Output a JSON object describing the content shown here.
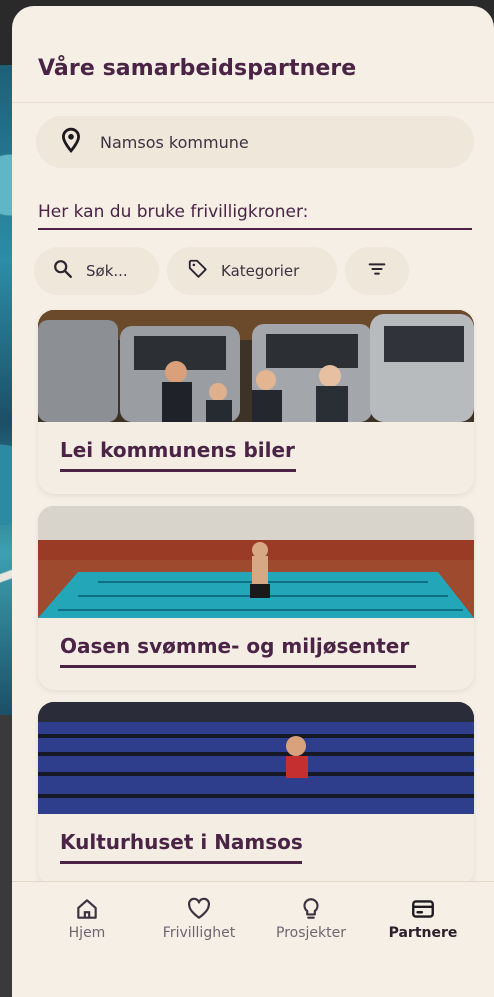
{
  "header": {
    "title": "Våre samarbeidspartnere"
  },
  "location": {
    "icon": "location-pin-icon",
    "label": "Namsos kommune"
  },
  "subtitle": "Her kan du bruke frivilligkroner:",
  "filters": {
    "search_label": "Søk...",
    "category_label": "Kategorier",
    "filter_icon": "filter-lines-icon"
  },
  "partners": [
    {
      "title": "Lei kommunens biler"
    },
    {
      "title": "Oasen svømme- og miljøsenter"
    },
    {
      "title": "Kulturhuset i Namsos"
    }
  ],
  "nav": {
    "items": [
      {
        "label": "Hjem",
        "icon": "home-icon",
        "active": false
      },
      {
        "label": "Frivillighet",
        "icon": "heart-icon",
        "active": false
      },
      {
        "label": "Prosjekter",
        "icon": "lightbulb-icon",
        "active": false
      },
      {
        "label": "Partnere",
        "icon": "card-icon",
        "active": true
      }
    ]
  },
  "colors": {
    "accent": "#4a2345",
    "background": "#f5efe6",
    "chip": "#efe7da"
  }
}
